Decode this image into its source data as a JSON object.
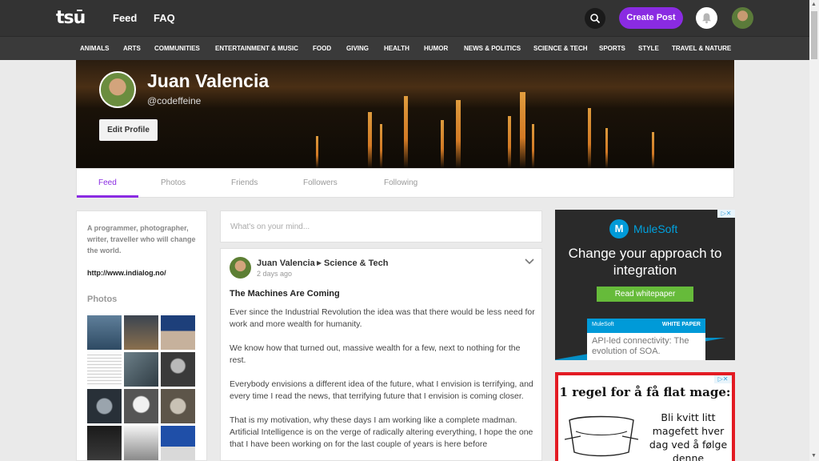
{
  "topbar": {
    "logo": "tsū",
    "nav": [
      {
        "label": "Feed"
      },
      {
        "label": "FAQ"
      }
    ],
    "create_post": "Create Post",
    "accent_color": "#8a2be2"
  },
  "categories": [
    "ANIMALS",
    "ARTS",
    "COMMUNITIES",
    "ENTERTAINMENT & MUSIC",
    "FOOD",
    "GIVING",
    "HEALTH",
    "HUMOR",
    "NEWS & POLITICS",
    "SCIENCE & TECH",
    "SPORTS",
    "STYLE",
    "TRAVEL & NATURE"
  ],
  "profile": {
    "name": "Juan Valencia",
    "handle": "@codeffeine",
    "edit_label": "Edit Profile"
  },
  "tabs": [
    {
      "label": "Feed",
      "active": true
    },
    {
      "label": "Photos"
    },
    {
      "label": "Friends"
    },
    {
      "label": "Followers"
    },
    {
      "label": "Following"
    }
  ],
  "sidebar": {
    "bio": "A programmer, photographer, writer, traveller who will change the world.",
    "website": "http://www.indialog.no/",
    "photos_title": "Photos"
  },
  "composer": {
    "placeholder": "What's on your mind..."
  },
  "post": {
    "author": "Juan Valencia",
    "category": "Science & Tech",
    "time": "2 days ago",
    "title": "The Machines Are Coming",
    "paragraphs": [
      "Ever since the Industrial Revolution the idea was that there would be less need for work and more wealth for humanity.",
      "We know how that turned out, massive wealth for a few, next to nothing for the rest.",
      "Everybody envisions a different idea of the future, what I envision is terrifying, and every time I read the news, that terrifying future that I envision is coming closer.",
      "That is my motivation, why these days I am working like a complete madman. Artificial Intelligence is on the verge of radically altering everything, I hope the one that I have been working on for the last couple of years is here before"
    ]
  },
  "ads": {
    "mulesoft": {
      "brand": "MuleSoft",
      "headline": "Change your approach to integration",
      "cta": "Read whitepaper",
      "panel_brand": "MuleSoft",
      "panel_label": "WHITE PAPER",
      "panel_text": "API-led connectivity: The evolution of SOA."
    },
    "second": {
      "headline": "1 regel for å få flat mage:",
      "text": "Bli kvitt litt magefett hver dag ved å følge denne"
    }
  }
}
